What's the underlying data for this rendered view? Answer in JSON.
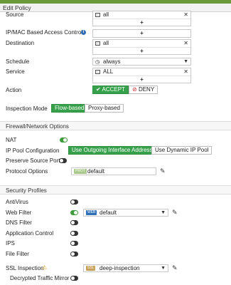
{
  "window": {
    "title": "Edit Policy"
  },
  "source": {
    "label": "Source",
    "value": "all",
    "add": "+"
  },
  "ipmac": {
    "label": "IP/MAC Based Access Control",
    "add": "+"
  },
  "destination": {
    "label": "Destination",
    "value": "all",
    "add": "+"
  },
  "schedule": {
    "label": "Schedule",
    "value": "always"
  },
  "service": {
    "label": "Service",
    "value": "ALL",
    "add": "+"
  },
  "action": {
    "label": "Action",
    "accept": "ACCEPT",
    "deny": "DENY",
    "selected": "ACCEPT"
  },
  "inspection_mode": {
    "label": "Inspection Mode",
    "flow": "Flow-based",
    "proxy": "Proxy-based",
    "selected": "Flow-based"
  },
  "firewall_section": {
    "title": "Firewall/Network Options"
  },
  "nat": {
    "label": "NAT",
    "enabled": true
  },
  "ip_pool": {
    "label": "IP Pool Configuration",
    "outgoing": "Use Outgoing Interface Address",
    "dynamic": "Use Dynamic IP Pool",
    "selected": "Use Outgoing Interface Address"
  },
  "preserve_source_port": {
    "label": "Preserve Source Port",
    "enabled": false
  },
  "protocol_options": {
    "label": "Protocol Options",
    "badge": "PROT",
    "value": "default"
  },
  "security_section": {
    "title": "Security Profiles"
  },
  "antivirus": {
    "label": "AntiVirus",
    "enabled": false
  },
  "web_filter": {
    "label": "Web Filter",
    "enabled": true,
    "badge": "WEB",
    "value": "default"
  },
  "dns_filter": {
    "label": "DNS Filter",
    "enabled": false
  },
  "app_control": {
    "label": "Application Control",
    "enabled": false
  },
  "ips": {
    "label": "IPS",
    "enabled": false
  },
  "file_filter": {
    "label": "File Filter",
    "enabled": false
  },
  "ssl_inspection": {
    "label": "SSL Inspection",
    "badge": "SSL",
    "value": "deep-inspection"
  },
  "decrypted_mirror": {
    "label": "Decrypted Traffic Mirror",
    "enabled": false
  },
  "colors": {
    "accent_green": "#36a14a",
    "header_green": "#6a9a3a",
    "web_badge": "#2f6fb8",
    "ssl_badge": "#c8a25a",
    "prot_badge": "#a9c98a"
  }
}
